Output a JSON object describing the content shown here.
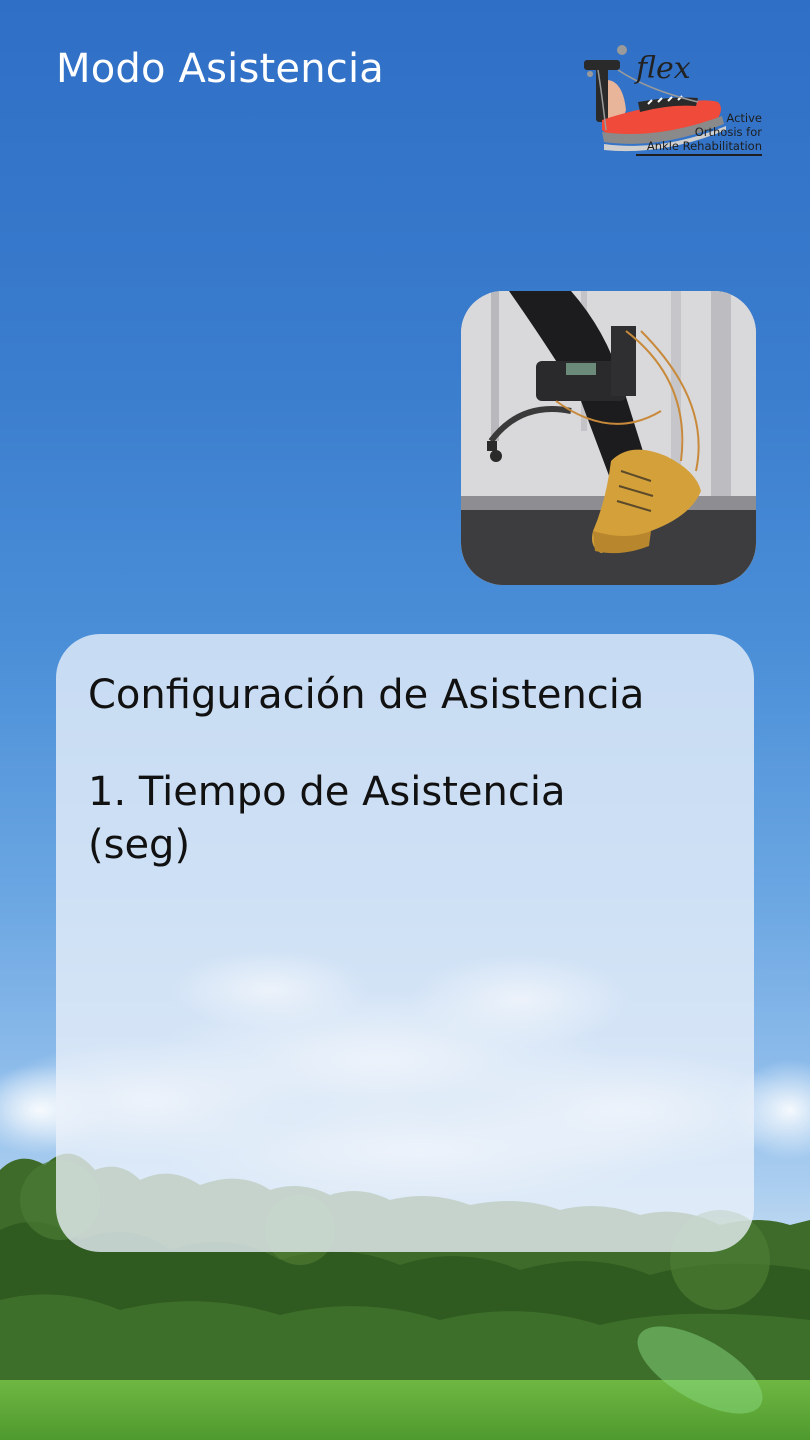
{
  "header": {
    "title": "Modo Asistencia"
  },
  "logo": {
    "brand_word": "flex",
    "line1": "Active",
    "line2": "Orthosis for",
    "line3": "Ankle Rehabilitation",
    "shoe_color": "#f04a3a"
  },
  "photo": {
    "description_icon": "ankle-orthosis-photo"
  },
  "config": {
    "heading": "Configuración de Asistencia",
    "field1_label": "1. Tiempo de Asistencia (seg)"
  },
  "colors": {
    "sky_top": "#2f6fc6",
    "card_bg": "#ebf1fa",
    "grass": "#5fa83a"
  }
}
